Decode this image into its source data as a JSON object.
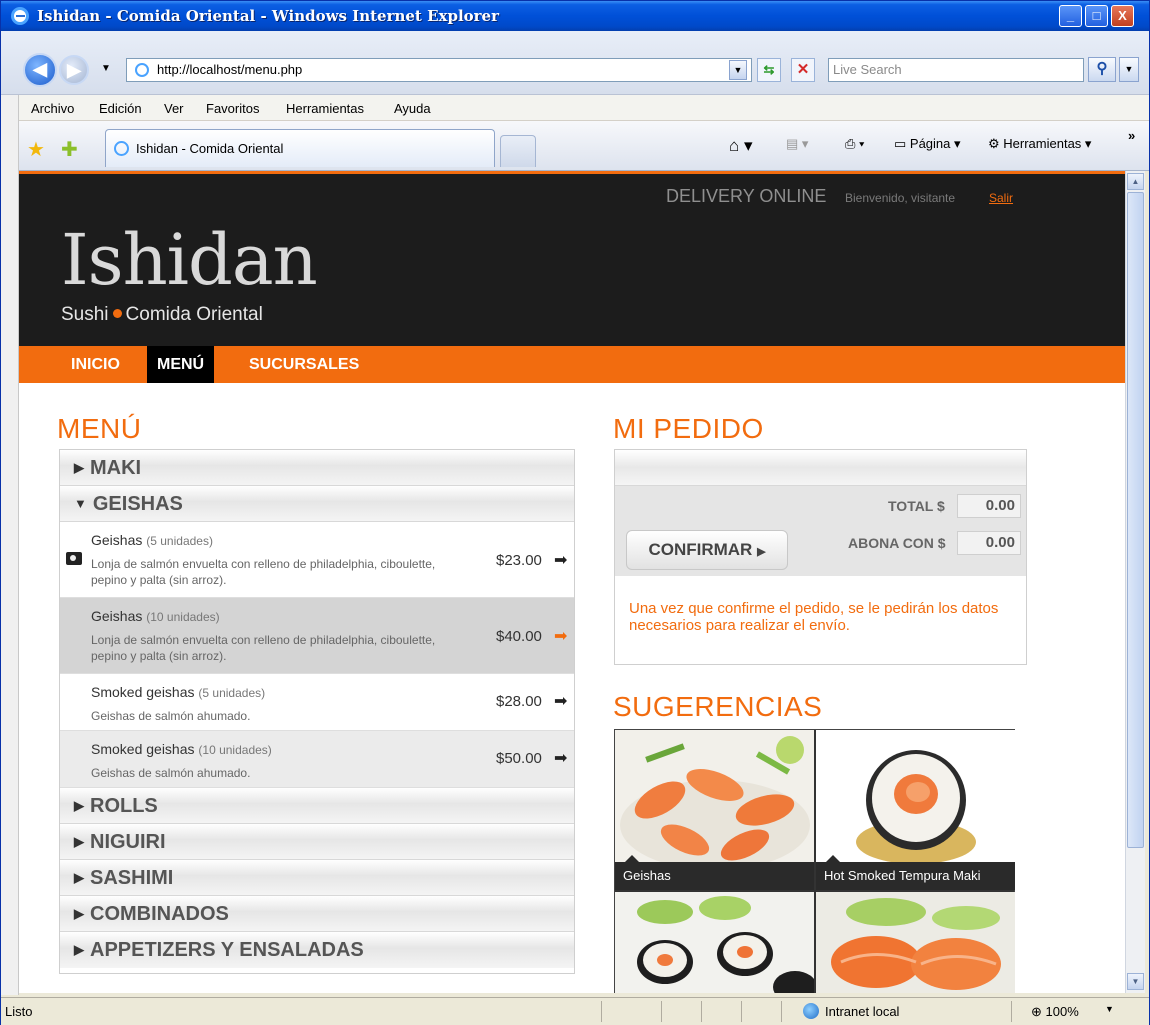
{
  "window": {
    "title": "Ishidan - Comida Oriental - Windows Internet Explorer",
    "buttons": {
      "minimize": "_",
      "maximize": "□",
      "close": "X"
    }
  },
  "browser": {
    "url": "http://localhost/menu.php",
    "search_placeholder": "Live Search",
    "menu": [
      "Archivo",
      "Edición",
      "Ver",
      "Favoritos",
      "Herramientas",
      "Ayuda"
    ],
    "tab_title": "Ishidan - Comida Oriental",
    "commands": {
      "page": "Página",
      "tools": "Herramientas",
      "more": "»"
    },
    "status": {
      "text": "Listo",
      "zone": "Intranet local",
      "zoom": "100%"
    }
  },
  "site": {
    "logo": "Ishidan",
    "tagline_left": "Sushi",
    "tagline_right": "Comida Oriental",
    "delivery": "DELIVERY ONLINE",
    "welcome": "Bienvenido, visitante",
    "logout": "Salir",
    "nav": [
      "INICIO",
      "MENÚ",
      "SUCURSALES"
    ],
    "accent_color": "#f26c0f"
  },
  "menu": {
    "heading": "MENÚ",
    "categories_top": [
      "MAKI",
      "GEISHAS"
    ],
    "items": [
      {
        "name": "Geishas",
        "units": "(5 unidades)",
        "desc": "Lonja de salmón envuelta con relleno de philadelphia, ciboulette, pepino y palta (sin arroz).",
        "price": "$23.00"
      },
      {
        "name": "Geishas",
        "units": "(10 unidades)",
        "desc": "Lonja de salmón envuelta con relleno de philadelphia, ciboulette, pepino y palta (sin arroz).",
        "price": "$40.00"
      },
      {
        "name": "Smoked geishas",
        "units": "(5 unidades)",
        "desc": "Geishas de salmón ahumado.",
        "price": "$28.00"
      },
      {
        "name": "Smoked geishas",
        "units": "(10 unidades)",
        "desc": "Geishas de salmón ahumado.",
        "price": "$50.00"
      }
    ],
    "categories_bottom": [
      "ROLLS",
      "NIGUIRI",
      "SASHIMI",
      "COMBINADOS",
      "APPETIZERS Y ENSALADAS"
    ]
  },
  "order": {
    "heading": "MI PEDIDO",
    "total_label": "TOTAL $",
    "total_value": "0.00",
    "pay_label": "ABONA CON $",
    "pay_value": "0.00",
    "confirm": "CONFIRMAR",
    "note": "Una vez que confirme el pedido, se le pedirán los datos necesarios para realizar el envío."
  },
  "suggestions": {
    "heading": "SUGERENCIAS",
    "items": [
      "Geishas",
      "Hot Smoked Tempura Maki"
    ]
  }
}
